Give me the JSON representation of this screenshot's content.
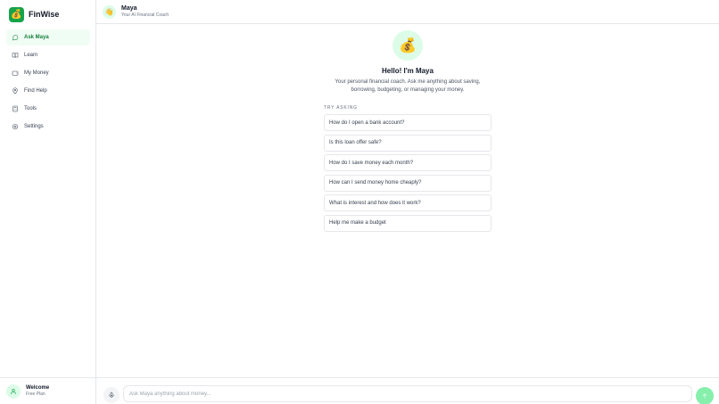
{
  "app": {
    "name": "FinWise",
    "logo_glyph": "💰",
    "logo_icon": "money-bag-icon",
    "brand_color": "#16a34a"
  },
  "sidebar": {
    "items": [
      {
        "label": "Ask Maya",
        "icon": "chat-icon",
        "active": true
      },
      {
        "label": "Learn",
        "icon": "book-icon",
        "active": false
      },
      {
        "label": "My Money",
        "icon": "wallet-icon",
        "active": false
      },
      {
        "label": "Find Help",
        "icon": "map-pin-icon",
        "active": false
      },
      {
        "label": "Tools",
        "icon": "calculator-icon",
        "active": false
      },
      {
        "label": "Settings",
        "icon": "gear-icon",
        "active": false
      }
    ],
    "user": {
      "name": "Welcome",
      "plan": "Free Plan",
      "icon": "user-icon"
    }
  },
  "header": {
    "avatar_glyph": "👋",
    "avatar_icon": "wave-icon",
    "name": "Maya",
    "subtitle": "Your AI Financial Coach"
  },
  "welcome": {
    "icon_glyph": "💰",
    "icon": "money-bag-icon",
    "title": "Hello! I'm Maya",
    "description": "Your personal financial coach. Ask me anything about saving, borrowing, budgeting, or managing your money."
  },
  "suggestions": {
    "label": "Try asking",
    "items": [
      "How do I open a bank account?",
      "Is this loan offer safe?",
      "How do I save money each month?",
      "How can I send money home cheaply?",
      "What is interest and how does it work?",
      "Help me make a budget"
    ]
  },
  "composer": {
    "placeholder": "Ask Maya anything about money...",
    "value": "",
    "mic_icon": "microphone-icon",
    "send_icon": "send-arrow-icon"
  }
}
